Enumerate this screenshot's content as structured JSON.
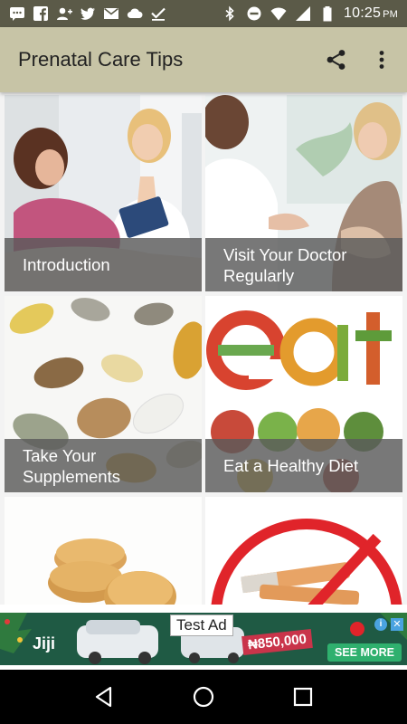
{
  "status_bar": {
    "time": "10:25",
    "ampm": "PM",
    "left_icons": [
      "chat-icon",
      "facebook-icon",
      "add-person-icon",
      "twitter-icon",
      "gmail-icon",
      "cloud-icon",
      "check-icon"
    ],
    "right_icons": [
      "bluetooth-icon",
      "do-not-disturb-icon",
      "wifi-icon",
      "signal-icon",
      "battery-icon"
    ]
  },
  "app_bar": {
    "title": "Prenatal Care Tips",
    "share_icon": "share-icon",
    "menu_icon": "more-vert-icon"
  },
  "tips": [
    {
      "label": "Introduction"
    },
    {
      "label": "Visit Your Doctor\nRegularly"
    },
    {
      "label": "Take Your\nSupplements"
    },
    {
      "label": "Eat a Healthy Diet"
    },
    {
      "label": ""
    },
    {
      "label": ""
    }
  ],
  "ad": {
    "test_label": "Test Ad",
    "brand": "Jiji",
    "price": "₦850,000",
    "cta": "SEE MORE"
  },
  "nav": {
    "back_icon": "back-icon",
    "home_icon": "home-icon",
    "recents_icon": "recents-icon"
  },
  "colors": {
    "status_bar": "#5b5a48",
    "app_bar": "#c7c4a6",
    "caption_overlay": "#5a5a5a",
    "nav_bar": "#000000",
    "ad_green": "#1f5a44"
  }
}
